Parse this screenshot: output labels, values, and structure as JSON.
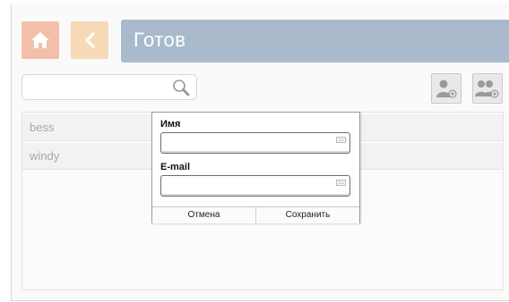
{
  "header": {
    "title": "Готов",
    "home_icon": "home-icon",
    "back_icon": "chevron-left-icon"
  },
  "search": {
    "placeholder": "",
    "value": ""
  },
  "toolbar": {
    "add_user_icon": "add-user-icon",
    "add_group_icon": "add-group-icon"
  },
  "list": {
    "items": [
      {
        "label": "bess"
      },
      {
        "label": "windy"
      }
    ]
  },
  "dialog": {
    "name_label": "Имя",
    "name_value": "",
    "email_label": "E-mail",
    "email_value": "",
    "cancel_label": "Отмена",
    "save_label": "Сохранить"
  },
  "colors": {
    "title_bar": "#a9bacd",
    "home_button": "#f3bfa8",
    "back_button": "#f7d9b8"
  }
}
